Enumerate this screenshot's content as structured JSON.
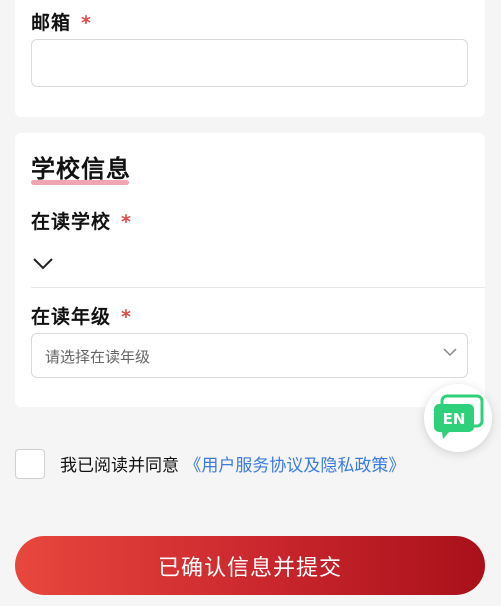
{
  "contact": {
    "email_label": "邮箱",
    "required_mark": "*",
    "email_value": ""
  },
  "school": {
    "title": "学校信息",
    "school_label": "在读学校",
    "school_required": "*",
    "grade_label": "在读年级",
    "grade_required": "*",
    "grade_placeholder": "请选择在读年级"
  },
  "agreement": {
    "prefix": "我已阅读并同意",
    "link": "《用户服务协议及隐私政策》"
  },
  "submit_label": "已确认信息并提交",
  "language_button": "EN",
  "colors": {
    "required": "#e04848",
    "link": "#3a7be0",
    "button_gradient_start": "#e8473d",
    "button_gradient_end": "#a9101a",
    "language_icon": "#2fd07a",
    "title_underline": "#f0a5b1"
  }
}
